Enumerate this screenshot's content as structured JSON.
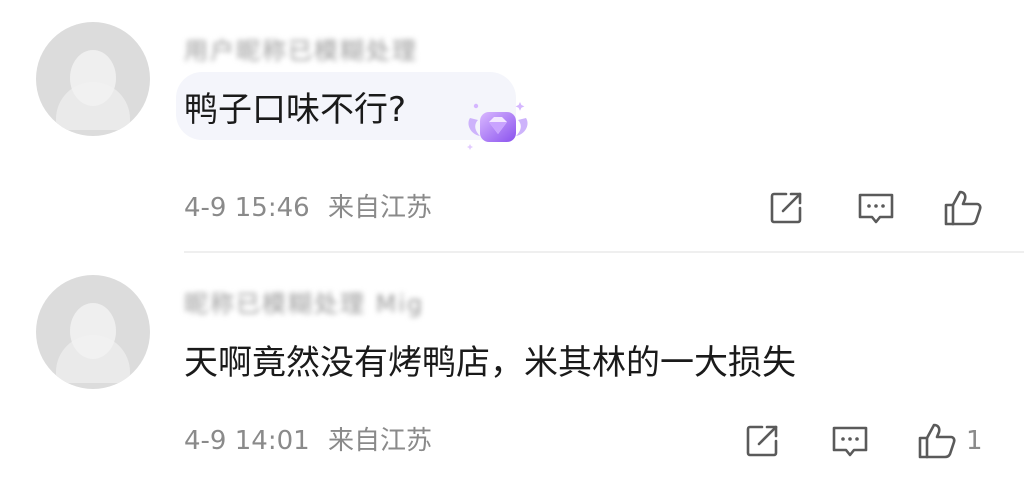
{
  "comments": [
    {
      "username": "用户昵称已模糊处理",
      "text": "鸭子口味不行?",
      "time": "4-9 15:46",
      "location": "来自江苏",
      "like_count": ""
    },
    {
      "username": "昵称已模糊处理 Mig",
      "text": "天啊竟然没有烤鸭店，米其林的一大损失",
      "time": "4-9 14:01",
      "location": "来自江苏",
      "like_count": "1"
    }
  ],
  "icons": {
    "share": "share-icon",
    "comment": "comment-icon",
    "like": "thumbs-up-icon",
    "badge": "diamond-badge-icon"
  },
  "colors": {
    "text": "#1a1a1a",
    "meta": "#8a8a8a",
    "icon": "#5a5a5a",
    "bubble": "#f4f5fb",
    "badge": "#9b6cf0"
  }
}
